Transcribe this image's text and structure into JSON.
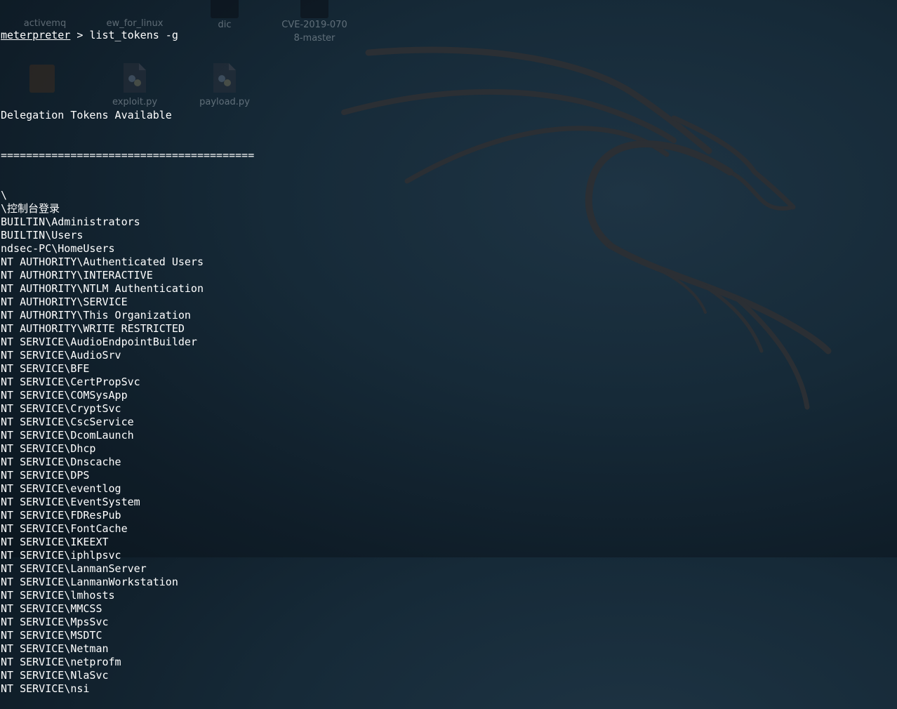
{
  "desktop": {
    "icons": [
      {
        "name": "desktop-icon-activemq",
        "label": "activemq"
      },
      {
        "name": "desktop-icon-ew-for-linux",
        "label": "ew_for_linux"
      },
      {
        "name": "desktop-icon-dic",
        "label": "dic"
      },
      {
        "name": "desktop-icon-cve",
        "label_line1": "CVE-2019-070",
        "label_line2": "8-master"
      },
      {
        "name": "desktop-icon-exploit",
        "label": "exploit.py"
      },
      {
        "name": "desktop-icon-payload",
        "label": "payload.py"
      }
    ]
  },
  "terminal": {
    "prompt": "meterpreter",
    "prompt_separator": " > ",
    "command": "list_tokens -g",
    "heading": "Delegation Tokens Available",
    "divider": "========================================",
    "tokens": [
      "\\",
      "\\控制台登录",
      "BUILTIN\\Administrators",
      "BUILTIN\\Users",
      "ndsec-PC\\HomeUsers",
      "NT AUTHORITY\\Authenticated Users",
      "NT AUTHORITY\\INTERACTIVE",
      "NT AUTHORITY\\NTLM Authentication",
      "NT AUTHORITY\\SERVICE",
      "NT AUTHORITY\\This Organization",
      "NT AUTHORITY\\WRITE RESTRICTED",
      "NT SERVICE\\AudioEndpointBuilder",
      "NT SERVICE\\AudioSrv",
      "NT SERVICE\\BFE",
      "NT SERVICE\\CertPropSvc",
      "NT SERVICE\\COMSysApp",
      "NT SERVICE\\CryptSvc",
      "NT SERVICE\\CscService",
      "NT SERVICE\\DcomLaunch",
      "NT SERVICE\\Dhcp",
      "NT SERVICE\\Dnscache",
      "NT SERVICE\\DPS",
      "NT SERVICE\\eventlog",
      "NT SERVICE\\EventSystem",
      "NT SERVICE\\FDResPub",
      "NT SERVICE\\FontCache",
      "NT SERVICE\\IKEEXT",
      "NT SERVICE\\iphlpsvc",
      "NT SERVICE\\LanmanServer",
      "NT SERVICE\\LanmanWorkstation",
      "NT SERVICE\\lmhosts",
      "NT SERVICE\\MMCSS",
      "NT SERVICE\\MpsSvc",
      "NT SERVICE\\MSDTC",
      "NT SERVICE\\Netman",
      "NT SERVICE\\netprofm",
      "NT SERVICE\\NlaSvc",
      "NT SERVICE\\nsi"
    ]
  },
  "colors": {
    "terminal_text": "#ffffff",
    "background_center": "#1e3444",
    "background_edge": "#0b161f",
    "dragon": "#2a2e33"
  },
  "icons": {
    "dragon": "kali-dragon-logo",
    "python_file": "python-file-icon",
    "folder": "folder-icon"
  }
}
